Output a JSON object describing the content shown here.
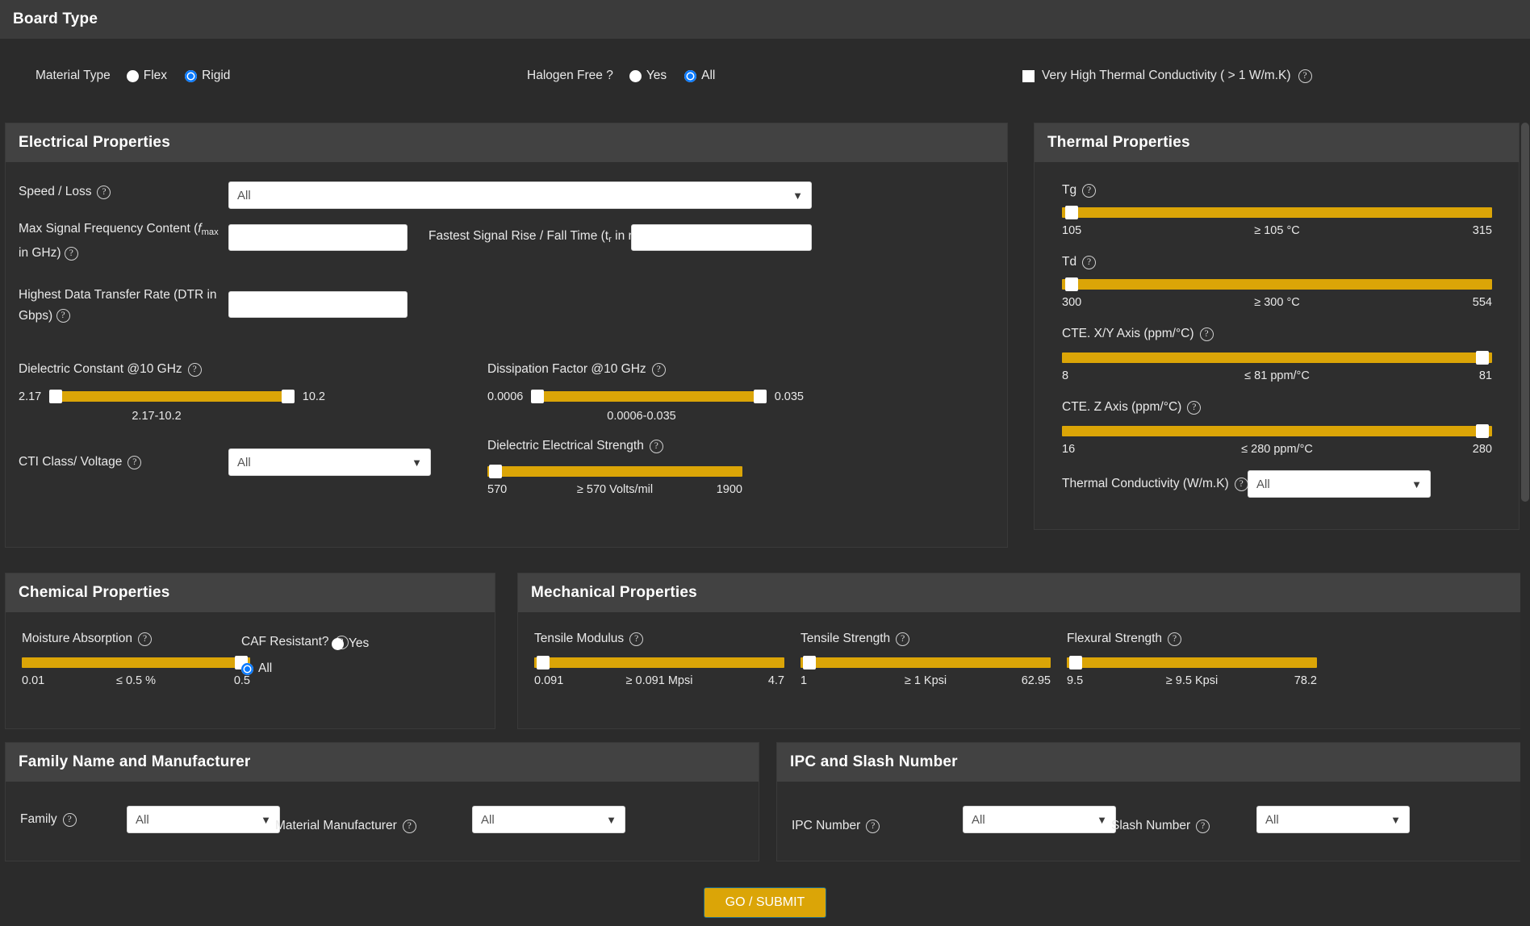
{
  "board_type": {
    "title": "Board Type",
    "material_type": {
      "label": "Material Type",
      "options": [
        "Flex",
        "Rigid"
      ],
      "selected": "Rigid"
    },
    "halogen_free": {
      "label": "Halogen Free ?",
      "options": [
        "Yes",
        "All"
      ],
      "selected": "All"
    },
    "vhtc": {
      "label": "Very High Thermal Conductivity ( > 1 W/m.K)",
      "checked": false,
      "help": "?"
    }
  },
  "electrical": {
    "title": "Electrical Properties",
    "speed_loss": {
      "label": "Speed / Loss",
      "value": "All",
      "help": "?"
    },
    "max_freq": {
      "label_a": "Max Signal Frequency Content (",
      "label_f": "f",
      "label_sub": "max",
      "label_b": " in GHz)",
      "value": "",
      "help": "?"
    },
    "rise_time": {
      "label_a": "Fastest Signal Rise / Fall Time (t",
      "label_sub": "r",
      "label_b": " in ns)",
      "value": "",
      "help": "?"
    },
    "dtr": {
      "label": "Highest Data Transfer Rate (DTR in Gbps)",
      "value": "",
      "help": "?"
    },
    "dielectric_constant": {
      "label": "Dielectric Constant @10 GHz",
      "min": "2.17",
      "max": "10.2",
      "caption": "2.17-10.2",
      "help": "?"
    },
    "dissipation_factor": {
      "label": "Dissipation Factor @10 GHz",
      "min": "0.0006",
      "max": "0.035",
      "caption": "0.0006-0.035",
      "help": "?"
    },
    "cti_class": {
      "label": "CTI Class/ Voltage",
      "value": "All",
      "help": "?"
    },
    "dielectric_strength": {
      "label": "Dielectric Electrical Strength",
      "min": "570",
      "mid": "≥  570 Volts/mil",
      "max": "1900",
      "help": "?"
    }
  },
  "thermal": {
    "title": "Thermal Properties",
    "tg": {
      "label": "Tg",
      "min": "105",
      "mid": "≥ 105 °C",
      "max": "315",
      "help": "?"
    },
    "td": {
      "label": "Td",
      "min": "300",
      "mid": "≥ 300 °C",
      "max": "554",
      "help": "?"
    },
    "cte_xy": {
      "label": "CTE. X/Y Axis (ppm/°C)",
      "min": "8",
      "mid": "≤ 81 ppm/°C",
      "max": "81",
      "help": "?"
    },
    "cte_z": {
      "label": "CTE. Z Axis (ppm/°C)",
      "min": "16",
      "mid": "≤ 280 ppm/°C",
      "max": "280",
      "help": "?"
    },
    "conductivity": {
      "label": "Thermal Conductivity (W/m.K)",
      "value": "All",
      "help": "?"
    }
  },
  "chemical": {
    "title": "Chemical Properties",
    "moisture": {
      "label": "Moisture Absorption",
      "min": "0.01",
      "mid": "≤ 0.5 %",
      "max": "0.5",
      "help": "?"
    },
    "caf": {
      "label": "CAF Resistant?",
      "options": [
        "Yes",
        "All"
      ],
      "selected": "All",
      "help": "?"
    }
  },
  "mechanical": {
    "title": "Mechanical Properties",
    "tensile_modulus": {
      "label": "Tensile Modulus",
      "min": "0.091",
      "mid": "≥ 0.091 Mpsi",
      "max": "4.7",
      "help": "?"
    },
    "tensile_strength": {
      "label": "Tensile Strength",
      "min": "1",
      "mid": "≥ 1 Kpsi",
      "max": "62.95",
      "help": "?"
    },
    "flexural_strength": {
      "label": "Flexural Strength",
      "min": "9.5",
      "mid": "≥ 9.5 Kpsi",
      "max": "78.2",
      "help": "?"
    }
  },
  "family": {
    "title": "Family Name and Manufacturer",
    "family": {
      "label": "Family",
      "value": "All",
      "help": "?"
    },
    "manufacturer": {
      "label": "Material Manufacturer",
      "value": "All",
      "help": "?"
    }
  },
  "ipc": {
    "title": "IPC and Slash Number",
    "ipc_number": {
      "label": "IPC Number",
      "value": "All",
      "help": "?"
    },
    "slash_number": {
      "label": "Slash Number",
      "value": "All",
      "help": "?"
    }
  },
  "submit": {
    "label": "GO / SUBMIT"
  },
  "colors": {
    "accent": "#dba507",
    "radio_on": "#0a7aff",
    "panel_head": "#424242",
    "bg": "#2b2b2b"
  }
}
